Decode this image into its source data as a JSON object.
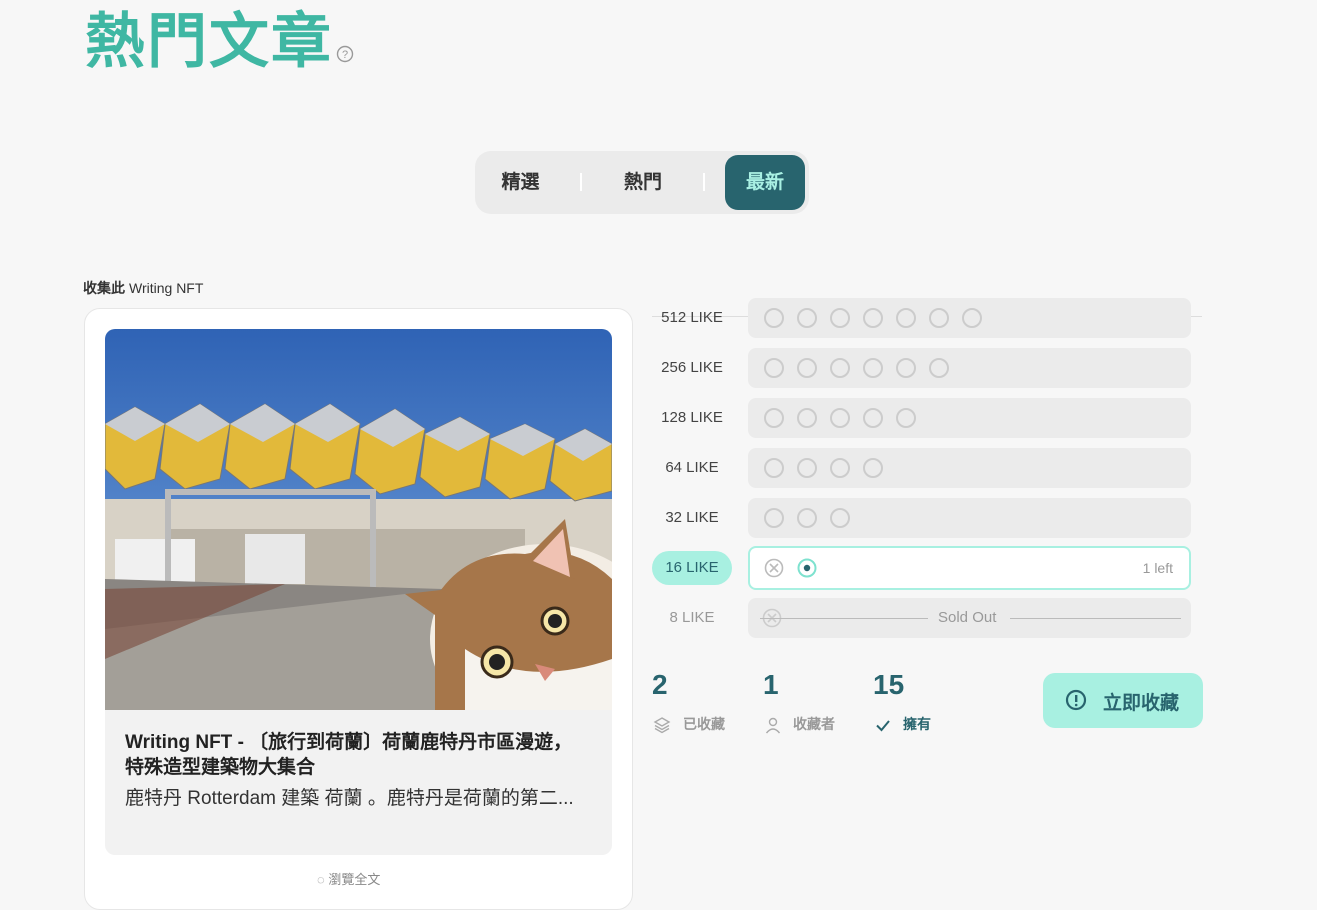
{
  "header": {
    "title": "熱門文章",
    "help_icon": "question-circle-icon"
  },
  "tabs": [
    {
      "label": "精選",
      "active": false
    },
    {
      "label": "熱門",
      "active": false
    },
    {
      "label": "最新",
      "active": true
    }
  ],
  "collect": {
    "prefix": "收集此",
    "name": "Writing NFT"
  },
  "card": {
    "title": "Writing NFT - 〔旅行到荷蘭〕荷蘭鹿特丹市區漫遊，特殊造型建築物大集合",
    "description": "鹿特丹 Rotterdam 建築 荷蘭 。鹿特丹是荷蘭的第二...",
    "footer_partial": "◌ 瀏覽全文"
  },
  "tiers": [
    {
      "label": "512 LIKE",
      "slots": 7
    },
    {
      "label": "256 LIKE",
      "slots": 6
    },
    {
      "label": "128 LIKE",
      "slots": 5
    },
    {
      "label": "64 LIKE",
      "slots": 4
    },
    {
      "label": "32 LIKE",
      "slots": 3
    },
    {
      "label": "16 LIKE",
      "slots": 2,
      "active": true,
      "remaining_text": "1 left"
    },
    {
      "label": "8 LIKE",
      "slots": 1,
      "sold_out_text": "Sold Out"
    }
  ],
  "stats": {
    "collected": {
      "value": "2",
      "label": "已收藏",
      "icon": "layers-icon"
    },
    "collectors": {
      "value": "1",
      "label": "收藏者",
      "icon": "person-icon"
    },
    "owned": {
      "value": "15",
      "label": "擁有",
      "icon": "check-icon"
    }
  },
  "collect_button": {
    "label": "立即收藏",
    "icon": "info-circle-icon"
  },
  "colors": {
    "accent": "#3fb7a3",
    "dark_teal": "#28646e",
    "mint": "#a8f0e1"
  }
}
